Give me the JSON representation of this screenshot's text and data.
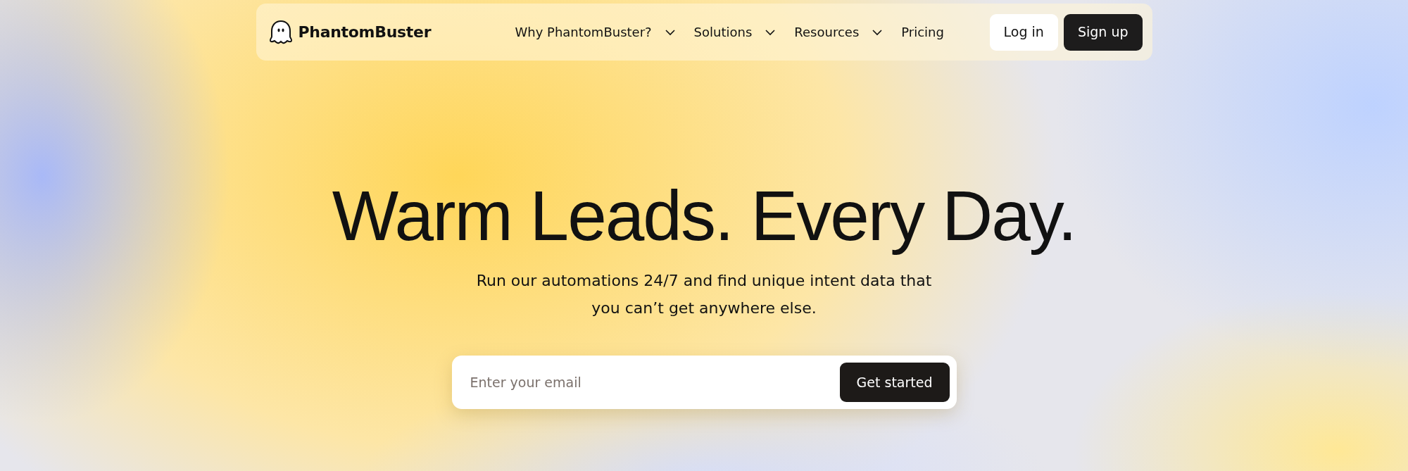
{
  "navbar": {
    "brand": "PhantomBuster",
    "items": [
      {
        "label": "Why PhantomBuster?",
        "kind": "dropdown"
      },
      {
        "label": "Solutions",
        "kind": "dropdown"
      },
      {
        "label": "Resources",
        "kind": "dropdown"
      },
      {
        "label": "Pricing",
        "kind": "link"
      }
    ],
    "buttons": [
      {
        "label": "Log in",
        "kind": "light"
      },
      {
        "label": "Sign up",
        "kind": "dark"
      }
    ]
  },
  "hero": {
    "title": "Warm Leads. Every Day.",
    "subtitle": "Run our automations 24/7 and find unique intent data that you can’t get anywhere else.",
    "email_field": {
      "placeholder": "Enter your email"
    },
    "cta": "Get started"
  }
}
